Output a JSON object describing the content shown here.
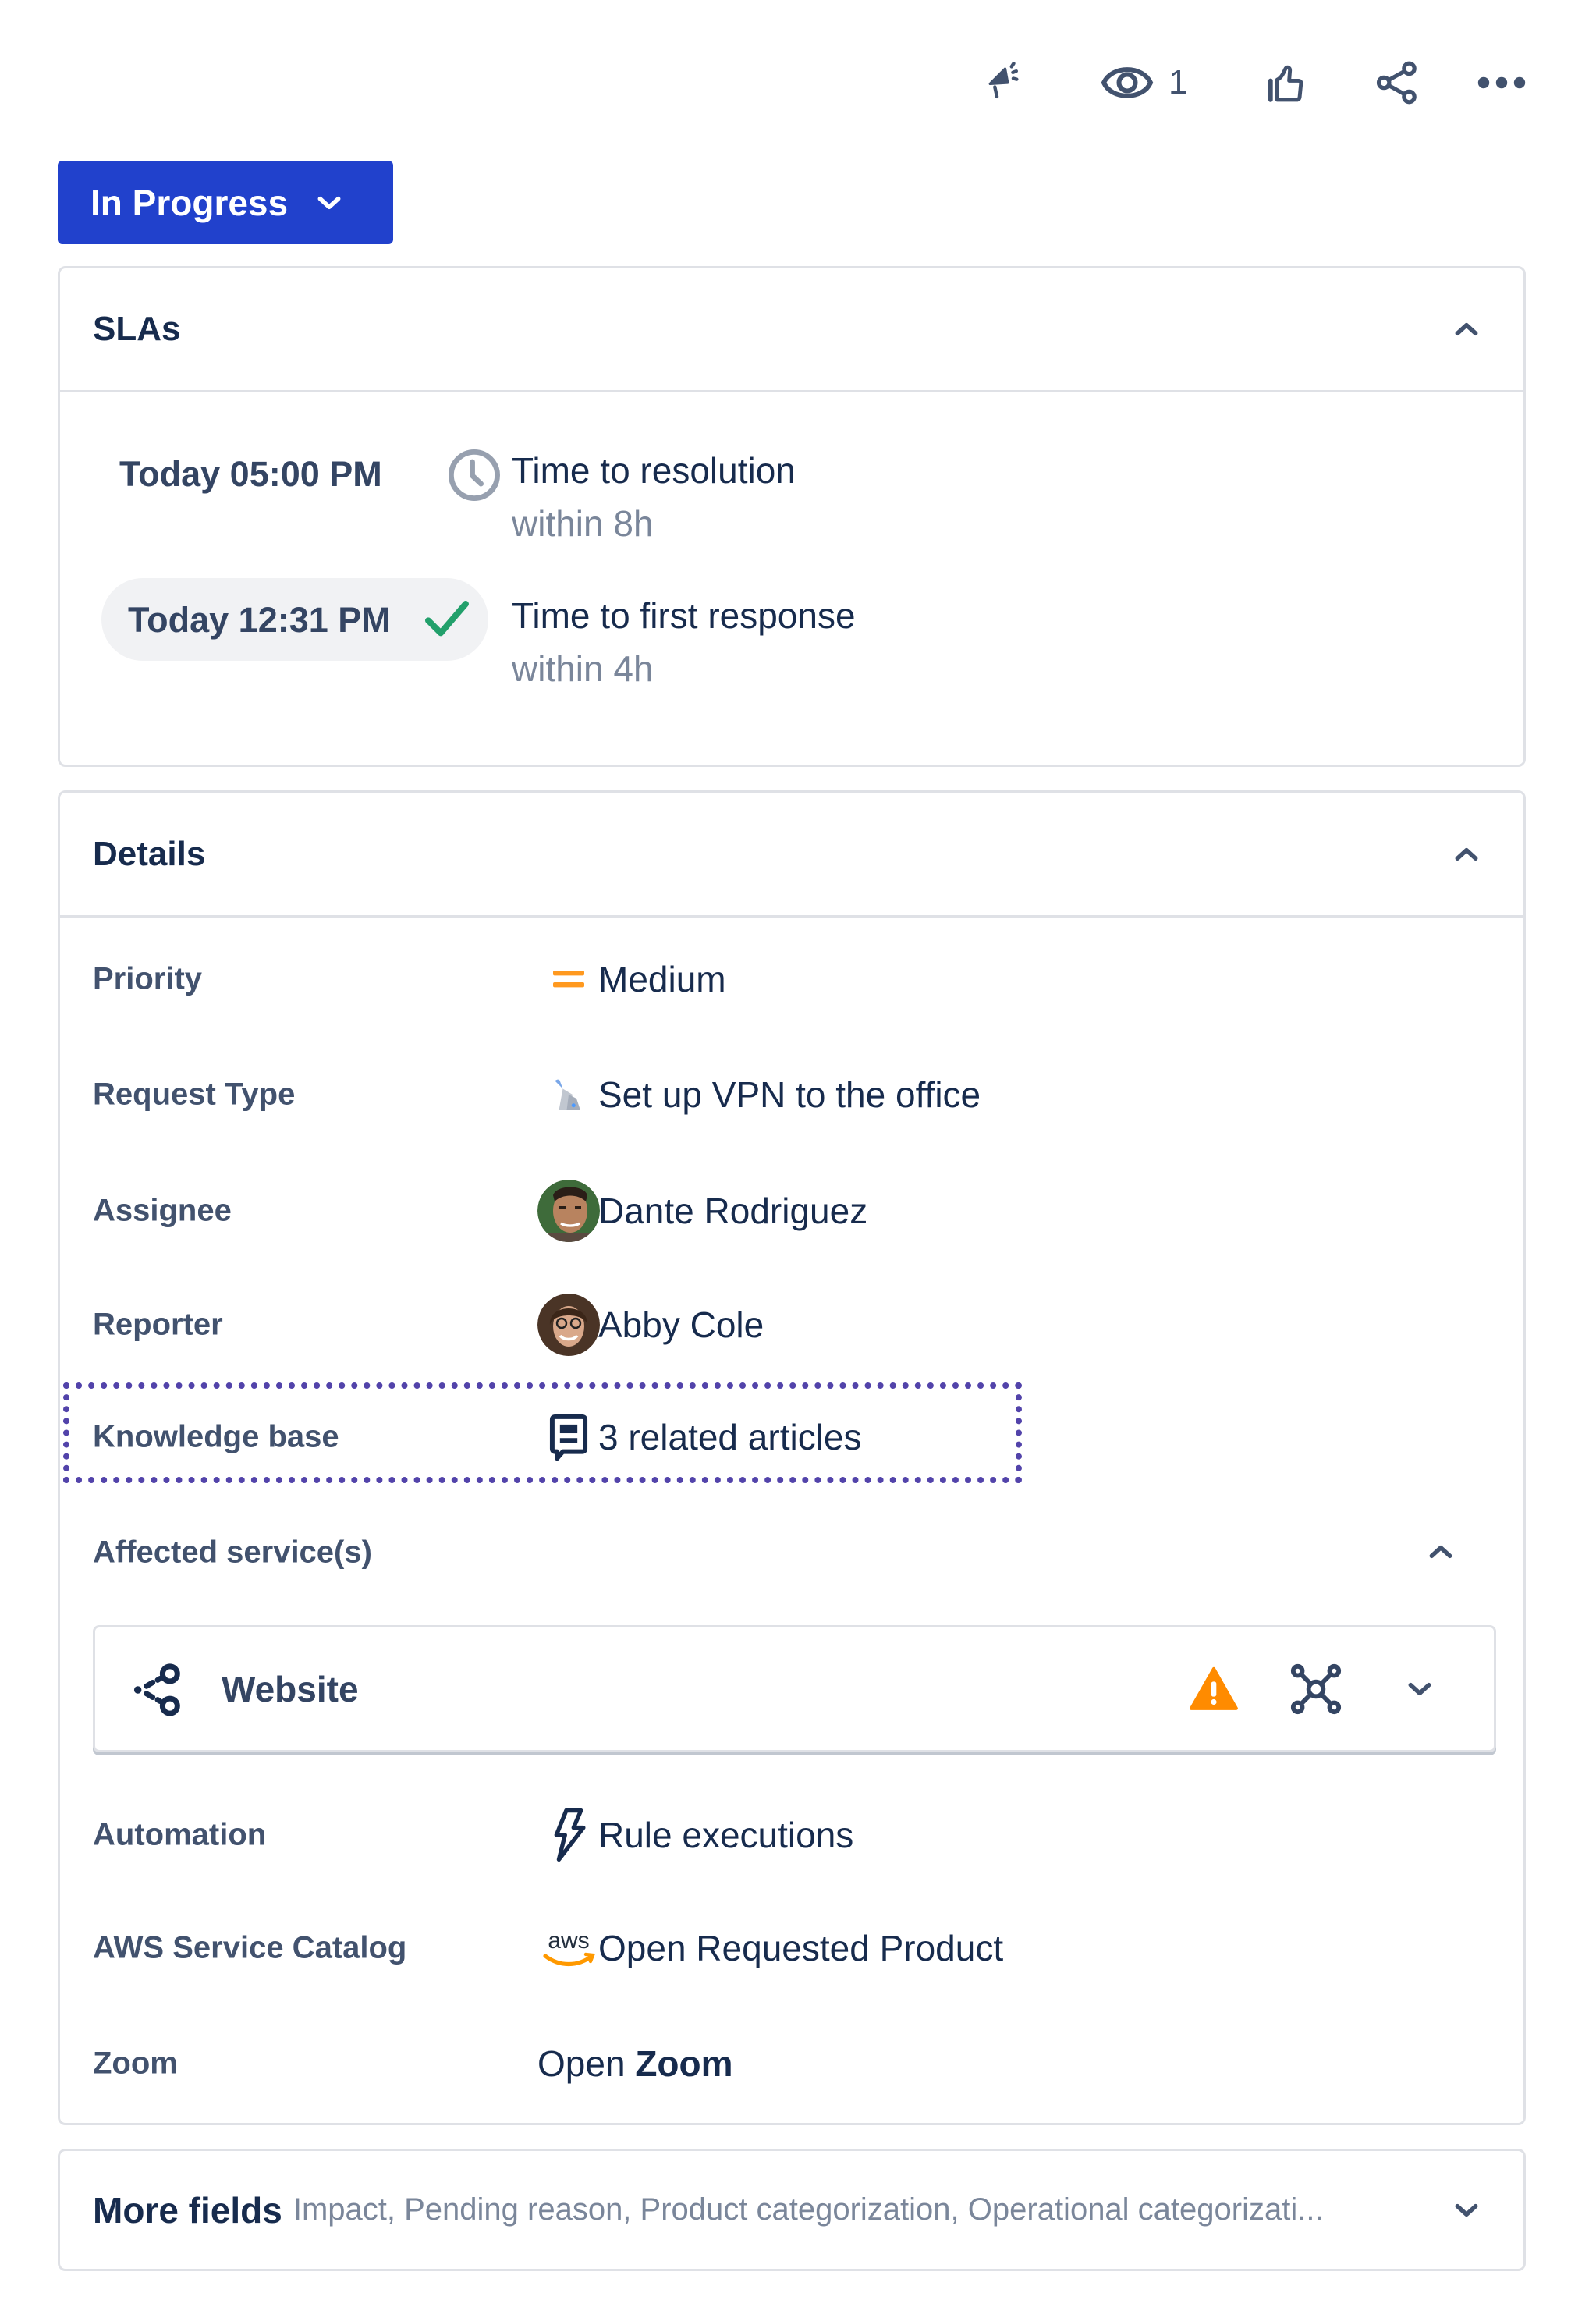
{
  "toolbar": {
    "feedback_icon": "megaphone-icon",
    "watch_icon": "eye-icon",
    "watch_count": "1",
    "vote_icon": "thumbs-up-icon",
    "share_icon": "share-icon",
    "more_icon": "more-horizontal-icon"
  },
  "status": {
    "label": "In Progress",
    "color": "#2141CC"
  },
  "slas": {
    "title": "SLAs",
    "items": [
      {
        "time": "Today 05:00 PM",
        "status_icon": "clock-icon",
        "title": "Time to resolution",
        "goal": "within 8h"
      },
      {
        "time": "Today 12:31 PM",
        "status_icon": "check-icon",
        "title": "Time to first response",
        "goal": "within 4h"
      }
    ]
  },
  "details": {
    "title": "Details",
    "fields": [
      {
        "label": "Priority",
        "icon": "priority-medium-icon",
        "value": "Medium",
        "color": "#FF991F"
      },
      {
        "label": "Request Type",
        "icon": "vpn-request-icon",
        "value": "Set up VPN to the office"
      },
      {
        "label": "Assignee",
        "icon": "avatar",
        "value": "Dante Rodriguez"
      },
      {
        "label": "Reporter",
        "icon": "avatar",
        "value": "Abby Cole"
      },
      {
        "label": "Knowledge base",
        "icon": "knowledge-article-icon",
        "value": "3 related articles"
      },
      {
        "label": "Affected service(s)"
      },
      {
        "label": "Automation",
        "icon": "lightning-icon",
        "value": "Rule executions"
      },
      {
        "label": "AWS Service Catalog",
        "icon": "aws-icon",
        "value": "Open Requested Product",
        "icon_text": "aws"
      },
      {
        "label": "Zoom",
        "value_prefix": "Open",
        "value_bold": "Zoom"
      }
    ],
    "affected_service": {
      "name": "Website",
      "service_icon": "service-icon",
      "alert_icon": "warning-icon",
      "alert_color": "#FF8B00",
      "dependency_icon": "dependencies-icon"
    }
  },
  "more_fields": {
    "label": "More fields",
    "summary": "Impact, Pending reason, Product categorization, Operational categorizati..."
  },
  "colors": {
    "highlight_border": "#5243AA",
    "success": "#22A06B",
    "text_primary": "#172B4D",
    "text_subtle": "#7A869A"
  }
}
